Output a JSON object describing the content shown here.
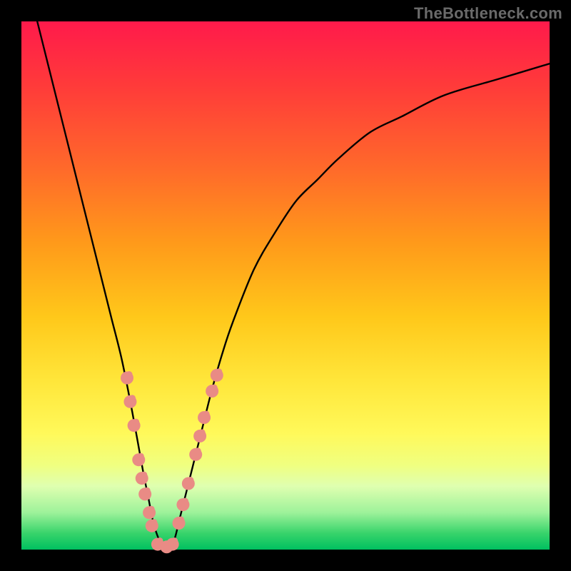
{
  "watermark": "TheBottleneck.com",
  "chart_data": {
    "type": "line",
    "title": "",
    "xlabel": "",
    "ylabel": "",
    "xlim": [
      0,
      100
    ],
    "ylim": [
      0,
      100
    ],
    "grid": false,
    "legend": false,
    "series": [
      {
        "name": "bottleneck-curve",
        "color": "#000000",
        "x": [
          3,
          5,
          7,
          9,
          11,
          13,
          15,
          17,
          19,
          21,
          23,
          24,
          25,
          26,
          27,
          28,
          29,
          30,
          32,
          34,
          36,
          38,
          40,
          44,
          48,
          52,
          56,
          60,
          66,
          72,
          80,
          90,
          100
        ],
        "y": [
          100,
          92,
          84,
          76,
          68,
          60,
          52,
          44,
          36,
          26,
          15,
          10,
          5,
          2,
          0,
          0,
          2,
          6,
          14,
          22,
          30,
          37,
          43,
          53,
          60,
          66,
          70,
          74,
          79,
          82,
          86,
          89,
          92
        ]
      }
    ],
    "markers": {
      "name": "highlighted-points",
      "color": "#e98b85",
      "radius_main": 9,
      "radius_small": 4.5,
      "points": [
        {
          "x": 20.0,
          "y": 32.5
        },
        {
          "x": 20.6,
          "y": 28.0
        },
        {
          "x": 21.3,
          "y": 23.5
        },
        {
          "x": 22.2,
          "y": 17.0
        },
        {
          "x": 22.8,
          "y": 13.5
        },
        {
          "x": 23.4,
          "y": 10.5
        },
        {
          "x": 24.2,
          "y": 7.0
        },
        {
          "x": 24.7,
          "y": 4.5
        },
        {
          "x": 25.8,
          "y": 1.0
        },
        {
          "x": 27.5,
          "y": 0.5
        },
        {
          "x": 28.6,
          "y": 1.0
        },
        {
          "x": 29.8,
          "y": 5.0
        },
        {
          "x": 30.6,
          "y": 8.5
        },
        {
          "x": 31.6,
          "y": 12.5
        },
        {
          "x": 33.0,
          "y": 18.0
        },
        {
          "x": 33.8,
          "y": 21.5
        },
        {
          "x": 34.6,
          "y": 25.0
        },
        {
          "x": 36.1,
          "y": 30.0
        },
        {
          "x": 37.0,
          "y": 33.0
        }
      ]
    }
  }
}
